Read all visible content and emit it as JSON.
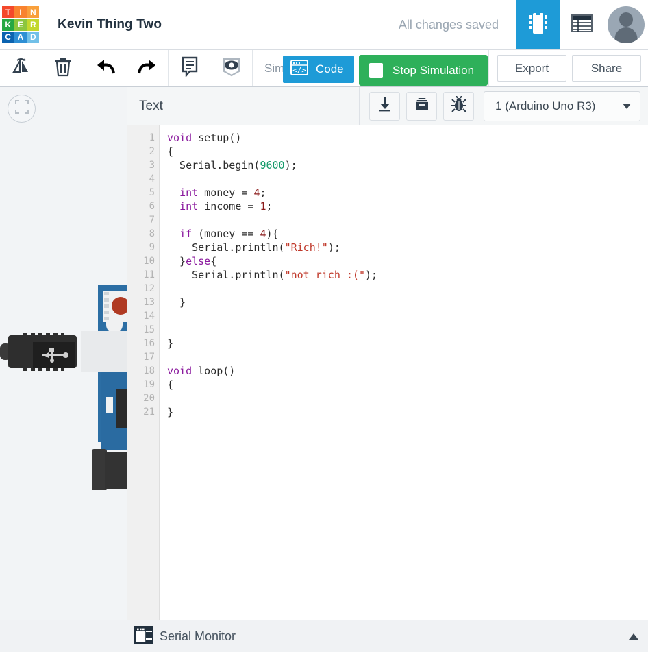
{
  "header": {
    "logo": {
      "name": "tinkercad-logo",
      "tiles": [
        {
          "letter": "T",
          "color": "#f4482b"
        },
        {
          "letter": "I",
          "color": "#f9832f"
        },
        {
          "letter": "N",
          "color": "#f9a03c"
        },
        {
          "letter": "K",
          "color": "#27a844"
        },
        {
          "letter": "E",
          "color": "#8cc63e"
        },
        {
          "letter": "R",
          "color": "#c3d82e"
        },
        {
          "letter": "C",
          "color": "#0b63b0"
        },
        {
          "letter": "A",
          "color": "#2e8fd4"
        },
        {
          "letter": "D",
          "color": "#72c0e8"
        }
      ]
    },
    "project_title": "Kevin Thing Two",
    "save_status": "All changes saved",
    "components_icon": "chip-icon",
    "list_icon": "component-list-icon",
    "avatar_label": "user-avatar",
    "accent_blue": "#1e9bd7"
  },
  "toolbar": {
    "buttons": [
      {
        "name": "rotate-icon",
        "label": "Rotate"
      },
      {
        "name": "delete-icon",
        "label": "Delete"
      },
      {
        "name": "undo-icon",
        "label": "Undo"
      },
      {
        "name": "redo-icon",
        "label": "Redo"
      },
      {
        "name": "notes-icon",
        "label": "Notes"
      },
      {
        "name": "visibility-icon",
        "label": "Visibility"
      }
    ],
    "sim_label": "Sim",
    "code_label": "Code",
    "stop_label": "Stop Simulation",
    "export_label": "Export",
    "share_label": "Share",
    "code_color": "#1e9bd7",
    "stop_color": "#2eb05a"
  },
  "canvas": {
    "fit_button": "zoom-to-fit",
    "board_name": "arduino-uno-board",
    "usb_name": "usb-connector"
  },
  "code_panel": {
    "mode_label": "Text",
    "download_label": "Download",
    "library_label": "Libraries",
    "debug_label": "Debugger",
    "board_selection": "1 (Arduino Uno R3)",
    "line_numbers": [
      1,
      2,
      3,
      4,
      5,
      6,
      7,
      8,
      9,
      10,
      11,
      12,
      13,
      14,
      15,
      16,
      17,
      18,
      19,
      20,
      21
    ],
    "code_lines": [
      [
        {
          "t": "void",
          "c": "kw"
        },
        {
          "t": " setup()",
          "c": ""
        }
      ],
      [
        {
          "t": "{",
          "c": ""
        }
      ],
      [
        {
          "t": "  Serial.begin(",
          "c": ""
        },
        {
          "t": "9600",
          "c": "num"
        },
        {
          "t": ");",
          "c": ""
        }
      ],
      [],
      [
        {
          "t": "  ",
          "c": ""
        },
        {
          "t": "int",
          "c": "kw"
        },
        {
          "t": " money = ",
          "c": ""
        },
        {
          "t": "4",
          "c": "numr"
        },
        {
          "t": ";",
          "c": ""
        }
      ],
      [
        {
          "t": "  ",
          "c": ""
        },
        {
          "t": "int",
          "c": "kw"
        },
        {
          "t": " income = ",
          "c": ""
        },
        {
          "t": "1",
          "c": "numr"
        },
        {
          "t": ";",
          "c": ""
        }
      ],
      [],
      [
        {
          "t": "  ",
          "c": ""
        },
        {
          "t": "if",
          "c": "kw"
        },
        {
          "t": " (money == ",
          "c": ""
        },
        {
          "t": "4",
          "c": "numr"
        },
        {
          "t": "){",
          "c": ""
        }
      ],
      [
        {
          "t": "    Serial.println(",
          "c": ""
        },
        {
          "t": "\"Rich!\"",
          "c": "str"
        },
        {
          "t": ");",
          "c": ""
        }
      ],
      [
        {
          "t": "  }",
          "c": ""
        },
        {
          "t": "else",
          "c": "kw"
        },
        {
          "t": "{",
          "c": ""
        }
      ],
      [
        {
          "t": "    Serial.println(",
          "c": ""
        },
        {
          "t": "\"not rich :(\"",
          "c": "str"
        },
        {
          "t": ");",
          "c": ""
        }
      ],
      [],
      [
        {
          "t": "  }",
          "c": ""
        }
      ],
      [],
      [],
      [
        {
          "t": "}",
          "c": ""
        }
      ],
      [],
      [
        {
          "t": "void",
          "c": "kw"
        },
        {
          "t": " loop()",
          "c": ""
        }
      ],
      [
        {
          "t": "{",
          "c": ""
        }
      ],
      [],
      [
        {
          "t": "}",
          "c": ""
        }
      ]
    ]
  },
  "serial_monitor": {
    "label": "Serial Monitor",
    "icon": "serial-window-icon",
    "collapse_icon": "chevron-up-icon"
  }
}
